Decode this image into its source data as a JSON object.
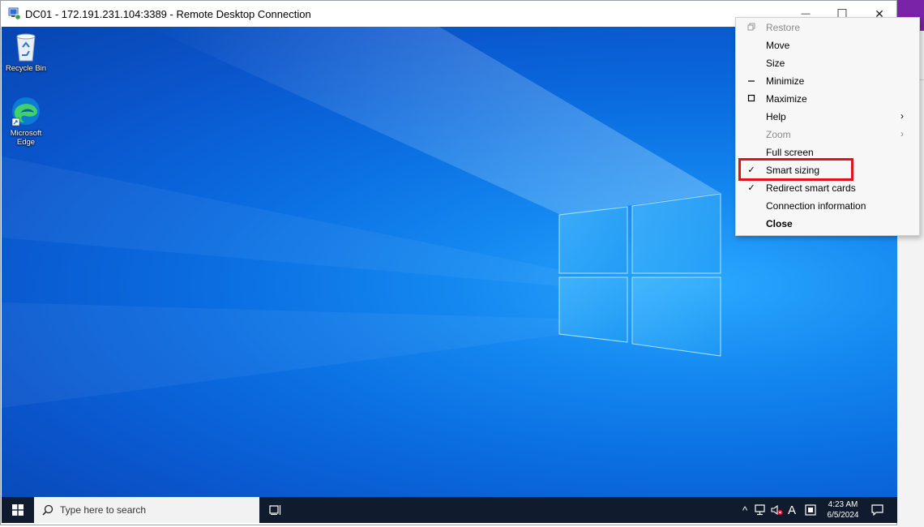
{
  "window": {
    "title": "DC01 - 172.191.231.104:3389 - Remote Desktop Connection",
    "controls": {
      "minimize": "—",
      "maximize": "☐",
      "close": "✕"
    }
  },
  "desktop": {
    "icons": [
      {
        "label": "Recycle Bin",
        "icon": "recycle-bin-icon"
      },
      {
        "label": "Microsoft Edge",
        "icon": "edge-icon"
      }
    ]
  },
  "taskbar": {
    "search_placeholder": "Type here to search",
    "tray": {
      "chevron": "^",
      "ime": "A",
      "time": "4:23 AM",
      "date": "6/5/2024"
    }
  },
  "context_menu": {
    "items": [
      {
        "label": "Restore",
        "state": "disabled",
        "mark": "restore"
      },
      {
        "label": "Move"
      },
      {
        "label": "Size"
      },
      {
        "label": "Minimize",
        "mark": "minimize"
      },
      {
        "label": "Maximize",
        "mark": "maximize"
      },
      {
        "label": "Help",
        "submenu": true
      },
      {
        "label": "Zoom",
        "state": "disabled",
        "submenu": true
      },
      {
        "label": "Full screen"
      },
      {
        "label": "Smart sizing",
        "checked": true,
        "highlighted": true
      },
      {
        "label": "Redirect smart cards",
        "checked": true
      },
      {
        "label": "Connection information"
      },
      {
        "label": "Close",
        "bold": true
      }
    ],
    "checkmark": "✓",
    "submenu_arrow": "›"
  },
  "colors": {
    "highlight": "#e0141e",
    "taskbar": "#101b2d",
    "host_accent": "#7a22a8"
  }
}
